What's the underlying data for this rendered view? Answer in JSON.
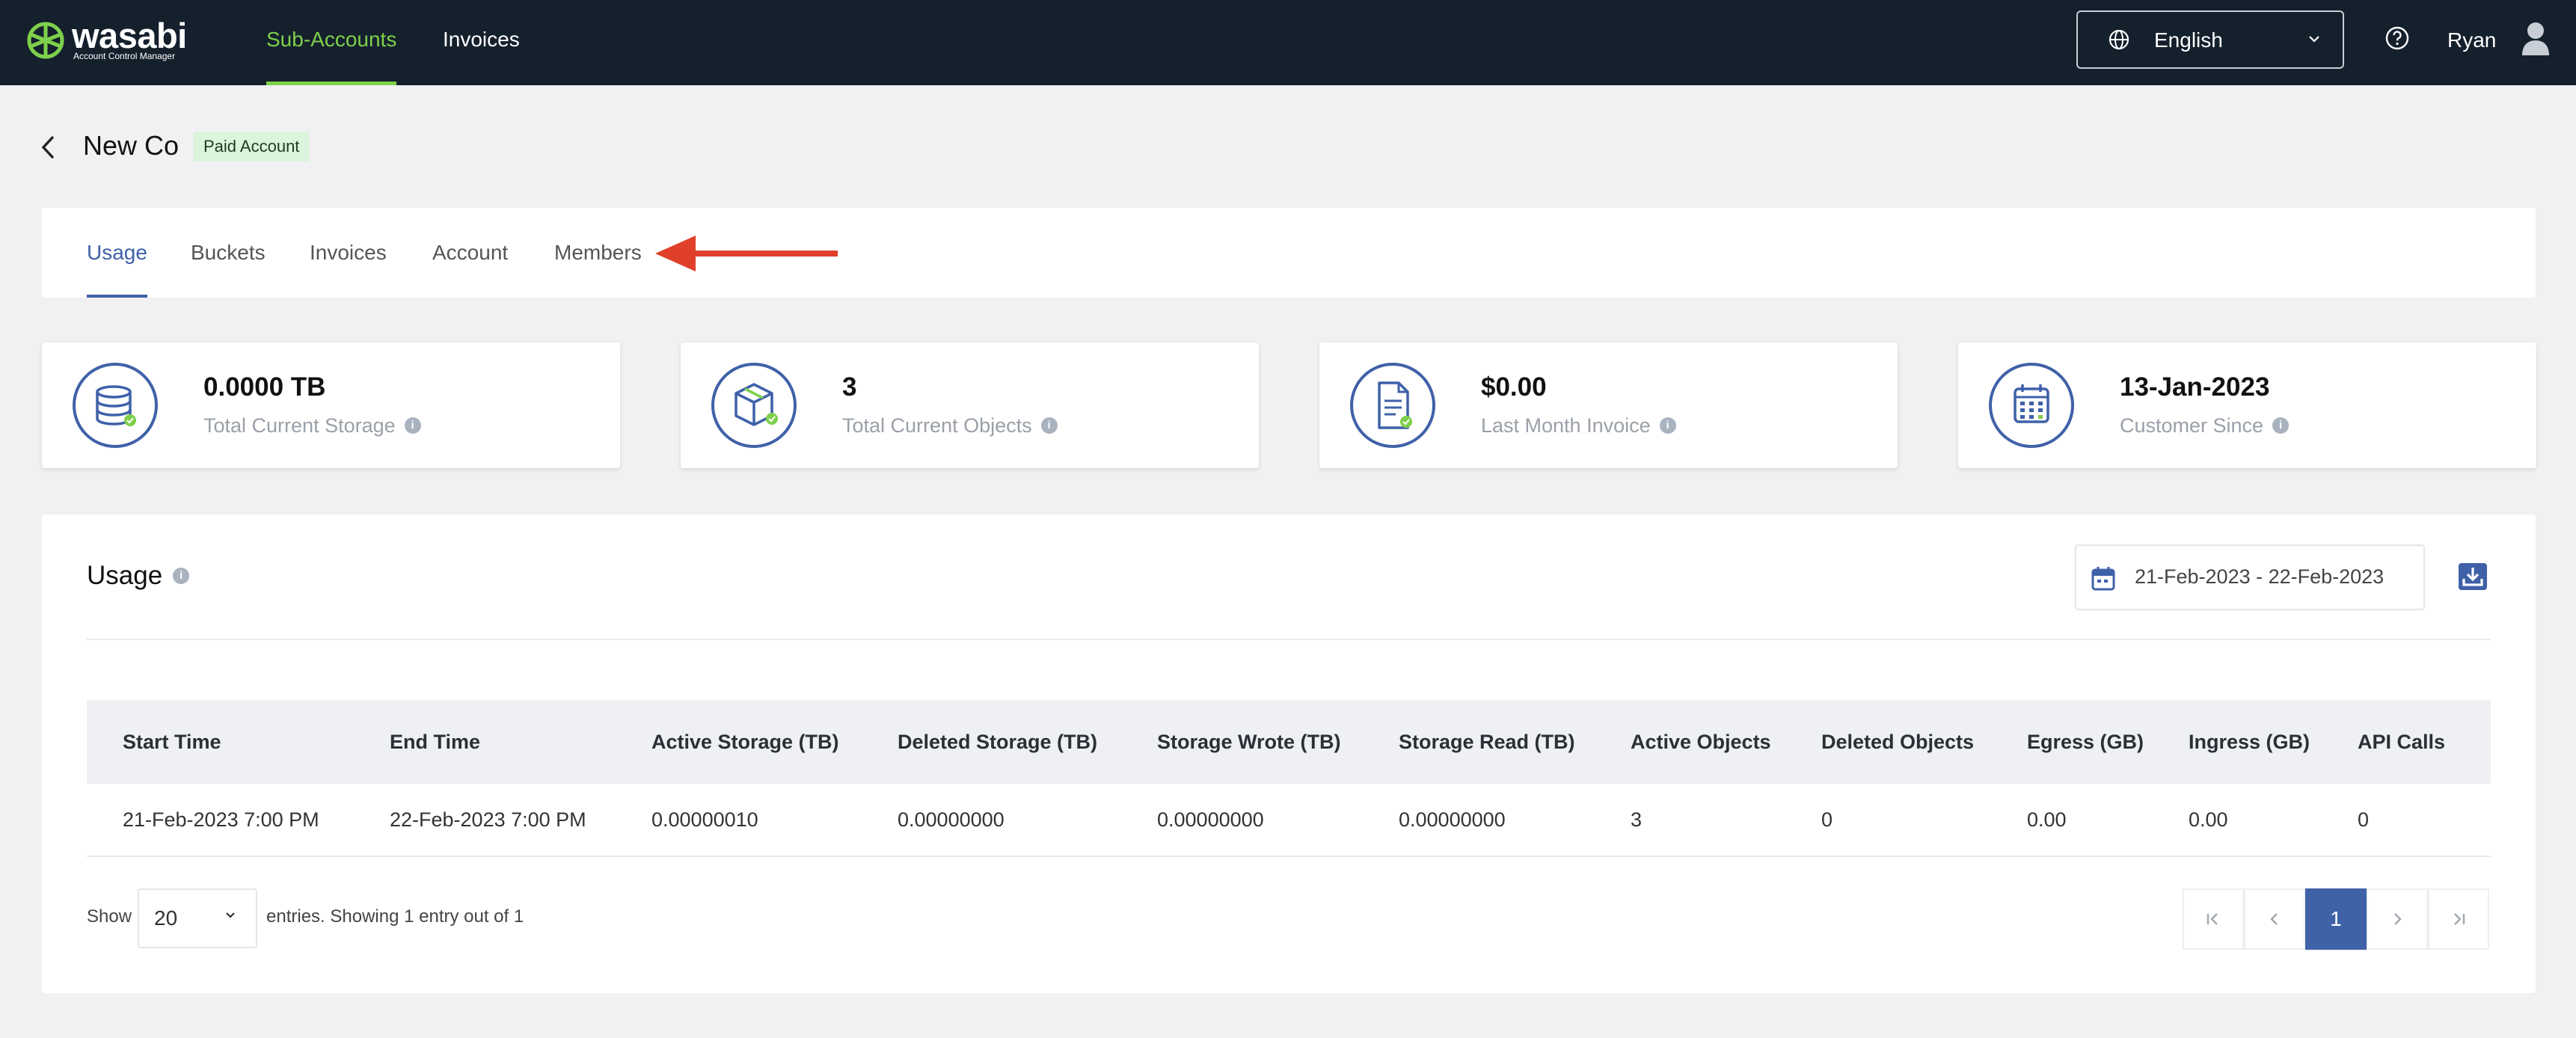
{
  "brand": {
    "name": "wasabi",
    "subtitle": "Account Control Manager",
    "accent_color": "#7ed04b"
  },
  "topnav": {
    "items": [
      {
        "label": "Sub-Accounts",
        "active": true
      },
      {
        "label": "Invoices",
        "active": false
      }
    ],
    "language": "English",
    "user": "Ryan"
  },
  "header": {
    "title": "New Co",
    "badge": "Paid Account"
  },
  "tabs": [
    {
      "label": "Usage",
      "active": true
    },
    {
      "label": "Buckets",
      "active": false
    },
    {
      "label": "Invoices",
      "active": false
    },
    {
      "label": "Account",
      "active": false
    },
    {
      "label": "Members",
      "active": false
    }
  ],
  "stats": [
    {
      "value": "0.0000 TB",
      "label": "Total Current Storage",
      "icon": "database-icon"
    },
    {
      "value": "3",
      "label": "Total Current Objects",
      "icon": "cube-icon"
    },
    {
      "value": "$0.00",
      "label": "Last Month Invoice",
      "icon": "invoice-icon"
    },
    {
      "value": "13-Jan-2023",
      "label": "Customer Since",
      "icon": "calendar-icon"
    }
  ],
  "usage": {
    "title": "Usage",
    "date_range": "21-Feb-2023 - 22-Feb-2023",
    "columns": [
      "Start Time",
      "End Time",
      "Active Storage (TB)",
      "Deleted Storage (TB)",
      "Storage Wrote (TB)",
      "Storage Read (TB)",
      "Active Objects",
      "Deleted Objects",
      "Egress (GB)",
      "Ingress (GB)",
      "API Calls"
    ],
    "rows": [
      [
        "21-Feb-2023 7:00 PM",
        "22-Feb-2023 7:00 PM",
        "0.00000010",
        "0.00000000",
        "0.00000000",
        "0.00000000",
        "3",
        "0",
        "0.00",
        "0.00",
        "0"
      ]
    ],
    "show_label": "Show",
    "page_size": "20",
    "entries_label": "entries.  Showing 1 entry out of 1",
    "current_page": "1"
  },
  "colors": {
    "nav_bg": "#15202d",
    "primary_blue": "#3f61a8",
    "annotation_arrow": "#e0402a"
  }
}
